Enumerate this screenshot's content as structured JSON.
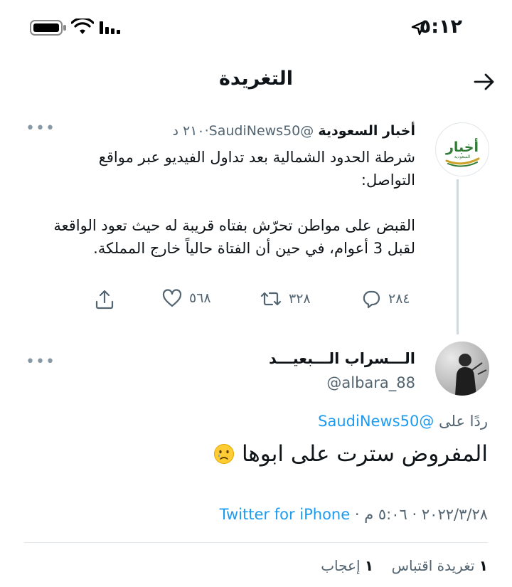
{
  "status_bar": {
    "time": "٥:١٢",
    "icons": [
      "location-arrow-icon",
      "signal-icon",
      "wifi-icon",
      "battery-icon"
    ]
  },
  "header": {
    "title": "التغريدة",
    "back_icon": "arrow-right-icon"
  },
  "tweet1": {
    "name": "أخبار السعودية",
    "handle": "@SaudiNews50",
    "time": "٢١٠ د",
    "avatar_logo": {
      "main": "أخبار",
      "sub": "السعودية"
    },
    "text_line1": "شرطة الحدود الشمالية بعد تداول الفيديو عبر مواقع التواصل:",
    "text_line2": "القبض على مواطن تحرّش بفتاه قريبة له حيث تعود الواقعة لقبل 3 أعوام، في حين أن الفتاة حالياً خارج المملكة.",
    "replies": "٢٨٤",
    "retweets": "٣٢٨",
    "likes": "٥٦٨",
    "more": "•••"
  },
  "tweet2": {
    "name": "الـــسراب الـــبعيـــد",
    "handle": "@albara_88",
    "replying_prefix": "ردًا على",
    "replying_to": "@SaudiNews50",
    "text": "المفروض سترت على ابوها",
    "emoji": "crying-face-emoji",
    "date": "٢٠٢٢/٣/٢٨",
    "time": "٥:٠٦ م",
    "source": "Twitter for iPhone",
    "quote_count": "١",
    "quote_label": "تغريدة اقتباس",
    "like_count": "١",
    "like_label": "إعجاب",
    "more": "•••"
  },
  "colors": {
    "accent": "#1d9bf0",
    "muted": "#536471",
    "text": "#0f1419"
  }
}
